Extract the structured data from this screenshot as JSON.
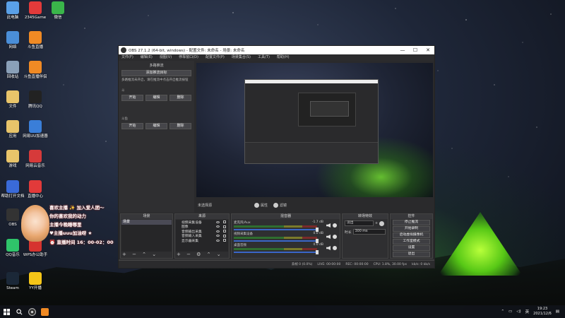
{
  "desktop": {
    "icons": [
      {
        "label": "此电脑",
        "color": "#5aa0e8"
      },
      {
        "label": "2345Game",
        "color": "#e23a3a"
      },
      {
        "label": "微信",
        "color": "#3ab54a"
      },
      {
        "label": "网络",
        "color": "#4a8ed8"
      },
      {
        "label": "斗鱼直播",
        "color": "#f08a24"
      },
      {
        "label": "回收站",
        "color": "#8aa0b8"
      },
      {
        "label": "斗鱼直播伴侣",
        "color": "#f08a24"
      },
      {
        "label": "文件",
        "color": "#e8c46a"
      },
      {
        "label": "腾讯QQ",
        "color": "#222222"
      },
      {
        "label": "应用",
        "color": "#e8c46a"
      },
      {
        "label": "网易UU加速器",
        "color": "#3a7ed8"
      },
      {
        "label": "游戏",
        "color": "#e8c46a"
      },
      {
        "label": "网易云音乐",
        "color": "#d63a3a"
      },
      {
        "label": "帮助打开文档",
        "color": "#3a6ad8"
      },
      {
        "label": "直播中心",
        "color": "#e23a3a"
      },
      {
        "label": "OBS",
        "color": "#333333"
      },
      {
        "label": "QQ音乐",
        "color": "#2fc46a"
      },
      {
        "label": "WPS办公助手",
        "color": "#d6332f"
      },
      {
        "label": "Steam",
        "color": "#1b2838"
      },
      {
        "label": "YY开播",
        "color": "#f5c518"
      }
    ]
  },
  "overlay": {
    "line1": "喜欢主播 ✨ 加入爱人团～",
    "line2": "你的喜欢我的动力",
    "line3": "主播今晚睡哪里",
    "line4": "♥主播uuu加油呀 ★",
    "line5": "⏰ 直播时间 16：00-02：00"
  },
  "obs": {
    "title": "OBS 27.1.2 (64-bit, windows) - 配置文件: 未命名 - 场景: 未命名",
    "menu": [
      "文件(F)",
      "编辑(E)",
      "视图(V)",
      "停靠窗口(D)",
      "配置文件(P)",
      "场景集合(S)",
      "工具(T)",
      "帮助(H)"
    ],
    "left_panel": {
      "title": "多路推流",
      "add_button": "添加推流目标",
      "note": "多路推流未开启，请在推流中点击开启推流按钮",
      "section1_label": "斗",
      "section2_label": "斗鱼",
      "start": "开始",
      "edit": "编辑",
      "delete": "删除"
    },
    "preview_footer": {
      "mode": "未选择源",
      "studio1": "属性",
      "studio2": "滤镜"
    },
    "docks": {
      "scenes_title": "场景",
      "scene_item": "场景",
      "sources_title": "来源",
      "sources": [
        "视频采集设备",
        "图像",
        "音频输出采集",
        "音频输入采集",
        "显示器采集"
      ],
      "mixer_title": "混音器",
      "mixer": [
        {
          "name": "麦克风/Aux",
          "db": "-1.7 dB"
        },
        {
          "name": "视频采集设备",
          "db": "0.0 dB"
        },
        {
          "name": "桌面音频",
          "db": "0.0 dB"
        }
      ],
      "transitions_title": "转场特效",
      "transition_select": "淡出",
      "duration_label": "时长",
      "duration_value": "300 ms",
      "controls_title": "控件",
      "controls": [
        "停止推流",
        "开始录制",
        "启动虚拟摄像机",
        "工作室模式",
        "设置",
        "退出"
      ]
    },
    "status": {
      "ltd": "LIVE: 00:00:00",
      "rec": "REC: 00:00:00",
      "cpu": "CPU: 1.8%, 30.00 fps",
      "drop": "丢帧 0 (0.0%)",
      "kbps": "kb/s: 0 kb/s"
    }
  },
  "taskbar": {
    "lang": "英",
    "time": "19:23",
    "date": "2021/12/6"
  }
}
